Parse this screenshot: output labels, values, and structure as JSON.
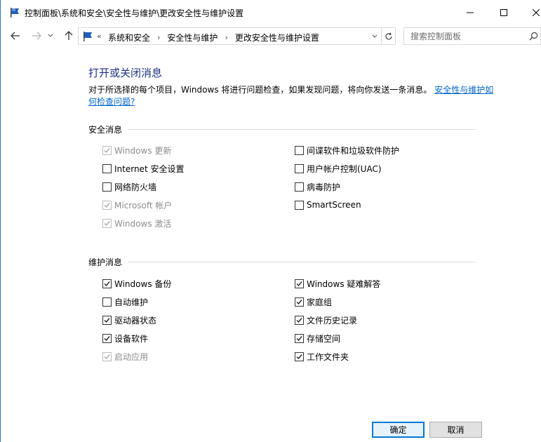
{
  "window": {
    "title": "控制面板\\系统和安全\\安全性与维护\\更改安全性与维护设置",
    "icon": "control-panel-flag-icon"
  },
  "address": {
    "start_chevron": "«",
    "crumbs": [
      "系统和安全",
      "安全性与维护",
      "更改安全性与维护设置"
    ]
  },
  "search": {
    "placeholder": "搜索控制面板",
    "value": ""
  },
  "main": {
    "heading": "打开或关闭消息",
    "description": "对于所选择的每个项目，Windows 将进行问题检查，如果发现问题，将向你发送一条消息。",
    "link": "安全性与维护如何检查问题?"
  },
  "security": {
    "title": "安全消息",
    "items": [
      {
        "label": "Windows 更新",
        "checked": true,
        "disabled": true
      },
      {
        "label": "Internet 安全设置",
        "checked": false,
        "disabled": false
      },
      {
        "label": "网络防火墙",
        "checked": false,
        "disabled": false
      },
      {
        "label": "Microsoft 帐户",
        "checked": true,
        "disabled": true
      },
      {
        "label": "Windows 激活",
        "checked": true,
        "disabled": true
      },
      {
        "label": "间谍软件和垃圾软件防护",
        "checked": false,
        "disabled": false
      },
      {
        "label": "用户帐户控制(UAC)",
        "checked": false,
        "disabled": false
      },
      {
        "label": "病毒防护",
        "checked": false,
        "disabled": false
      },
      {
        "label": "SmartScreen",
        "checked": false,
        "disabled": false
      }
    ]
  },
  "maintenance": {
    "title": "维护消息",
    "items": [
      {
        "label": "Windows 备份",
        "checked": true,
        "disabled": false
      },
      {
        "label": "自动维护",
        "checked": false,
        "disabled": false
      },
      {
        "label": "驱动器状态",
        "checked": true,
        "disabled": false
      },
      {
        "label": "设备软件",
        "checked": true,
        "disabled": false
      },
      {
        "label": "启动应用",
        "checked": true,
        "disabled": true
      },
      {
        "label": "Windows 疑难解答",
        "checked": true,
        "disabled": false
      },
      {
        "label": "家庭组",
        "checked": true,
        "disabled": false
      },
      {
        "label": "文件历史记录",
        "checked": true,
        "disabled": false
      },
      {
        "label": "存储空间",
        "checked": true,
        "disabled": false
      },
      {
        "label": "工作文件夹",
        "checked": true,
        "disabled": false
      }
    ]
  },
  "footer": {
    "ok_label": "确定",
    "cancel_label": "取消"
  },
  "colors": {
    "accent": "#0078d7",
    "heading": "#1e3287",
    "link": "#0066cc"
  }
}
